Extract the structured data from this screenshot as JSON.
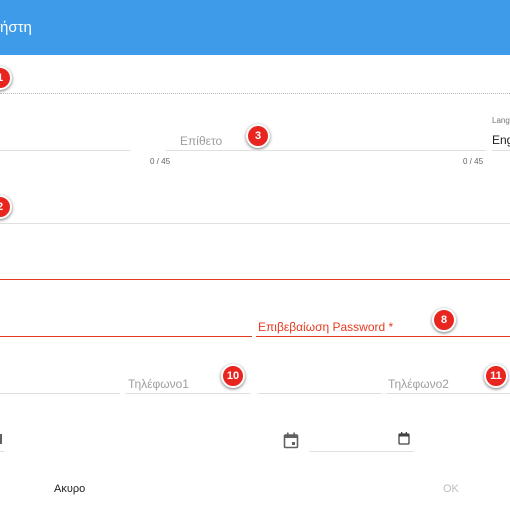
{
  "header": {
    "title": "ήστη"
  },
  "form": {
    "lastname": {
      "placeholder": "Επίθετο",
      "counter": "0 / 45"
    },
    "first_counter": "0 / 45",
    "language": {
      "label": "Lang",
      "value": "Eng"
    },
    "password_confirm": {
      "label": "Επιβεβαίωση Password *"
    },
    "phone1": {
      "placeholder": "Τηλέφωνο1"
    },
    "phone2": {
      "placeholder": "Τηλέφωνο2"
    }
  },
  "badges": {
    "b1": "1",
    "b2": "2",
    "b3": "3",
    "b8": "8",
    "b10": "10",
    "b11": "11"
  },
  "icons": {
    "date_left": "calendar-icon",
    "date_right": "calendar-icon"
  },
  "footer": {
    "cancel_label": "Ακυρο",
    "ok_label": "OK"
  },
  "colors": {
    "header": "#3d9be9",
    "error": "#e53a1f",
    "badge": "#e8261f"
  }
}
